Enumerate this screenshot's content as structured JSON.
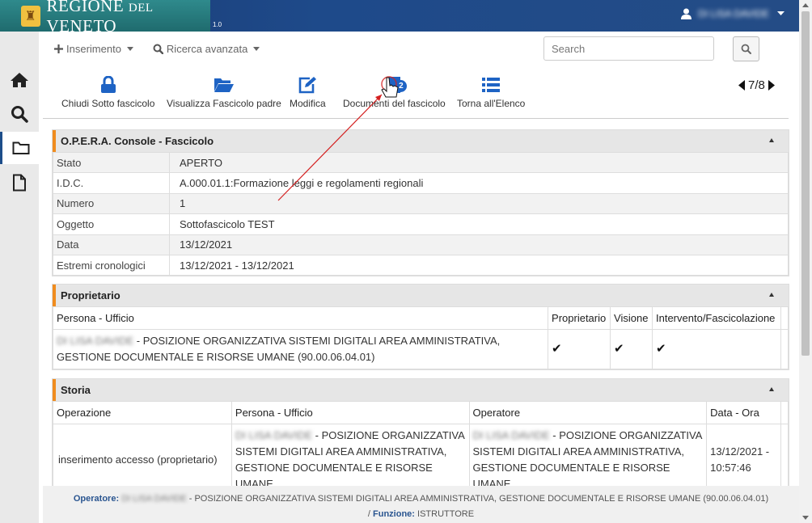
{
  "header": {
    "logo_main": "REGIONE",
    "logo_small": "DEL",
    "logo_main2": "VENETO",
    "version": "1.0",
    "user_name": "DI LISA DAVIDE"
  },
  "menu": {
    "insert_label": "Inserimento",
    "advanced_search_label": "Ricerca avanzata",
    "search_placeholder": "Search"
  },
  "toolbar": {
    "close_label": "Chiudi Sotto fascicolo",
    "view_parent_label": "Visualizza Fascicolo padre",
    "edit_label": "Modifica",
    "documents_label": "Documenti del fascicolo",
    "documents_badge": "2",
    "back_label": "Torna all'Elenco",
    "pager": "7/8"
  },
  "fascicolo": {
    "title": "O.P.E.R.A. Console - Fascicolo",
    "rows": [
      {
        "k": "Stato",
        "v": "APERTO"
      },
      {
        "k": "I.D.C.",
        "v": "A.000.01.1:Formazione leggi e regolamenti regionali"
      },
      {
        "k": "Numero",
        "v": "1"
      },
      {
        "k": "Oggetto",
        "v": "Sottofascicolo TEST"
      },
      {
        "k": "Data",
        "v": "13/12/2021"
      },
      {
        "k": "Estremi cronologici",
        "v": "13/12/2021 - 13/12/2021"
      }
    ]
  },
  "proprietario": {
    "title": "Proprietario",
    "headers": [
      "Persona - Ufficio",
      "Proprietario",
      "Visione",
      "Intervento/Fascicolazione"
    ],
    "row": {
      "persona": "DI LISA DAVIDE",
      "ufficio": " - POSIZIONE ORGANIZZATIVA SISTEMI DIGITALI AREA AMMINISTRATIVA, GESTIONE DOCUMENTALE E RISORSE UMANE  (90.00.06.04.01)"
    }
  },
  "storia": {
    "title": "Storia",
    "headers": [
      "Operazione",
      "Persona - Ufficio",
      "Operatore",
      "Data - Ora"
    ],
    "row": {
      "operazione": "inserimento accesso  (proprietario)",
      "persona": "DI LISA DAVIDE",
      "ufficio": " - POSIZIONE ORGANIZZATIVA SISTEMI DIGITALI AREA AMMINISTRATIVA, GESTIONE DOCUMENTALE E RISORSE UMANE",
      "operatore": "DI LISA DAVIDE",
      "operatore_ufficio": " - POSIZIONE ORGANIZZATIVA SISTEMI DIGITALI AREA AMMINISTRATIVA, GESTIONE DOCUMENTALE E RISORSE UMANE",
      "data": "13/12/2021 - 10:57:46"
    }
  },
  "footer": {
    "operatore_label": "Operatore:",
    "operatore_name": "DI LISA DAVIDE",
    "operatore_text": " - POSIZIONE ORGANIZZATIVA SISTEMI DIGITALI AREA AMMINISTRATIVA, GESTIONE DOCUMENTALE E RISORSE UMANE (90.00.06.04.01)",
    "funzione_label": "Funzione:",
    "funzione_value": "ISTRUTTORE"
  },
  "colors": {
    "header_blue": "#1e4a8a",
    "accent_orange": "#f08c1e",
    "icon_blue": "#1e63c4"
  }
}
